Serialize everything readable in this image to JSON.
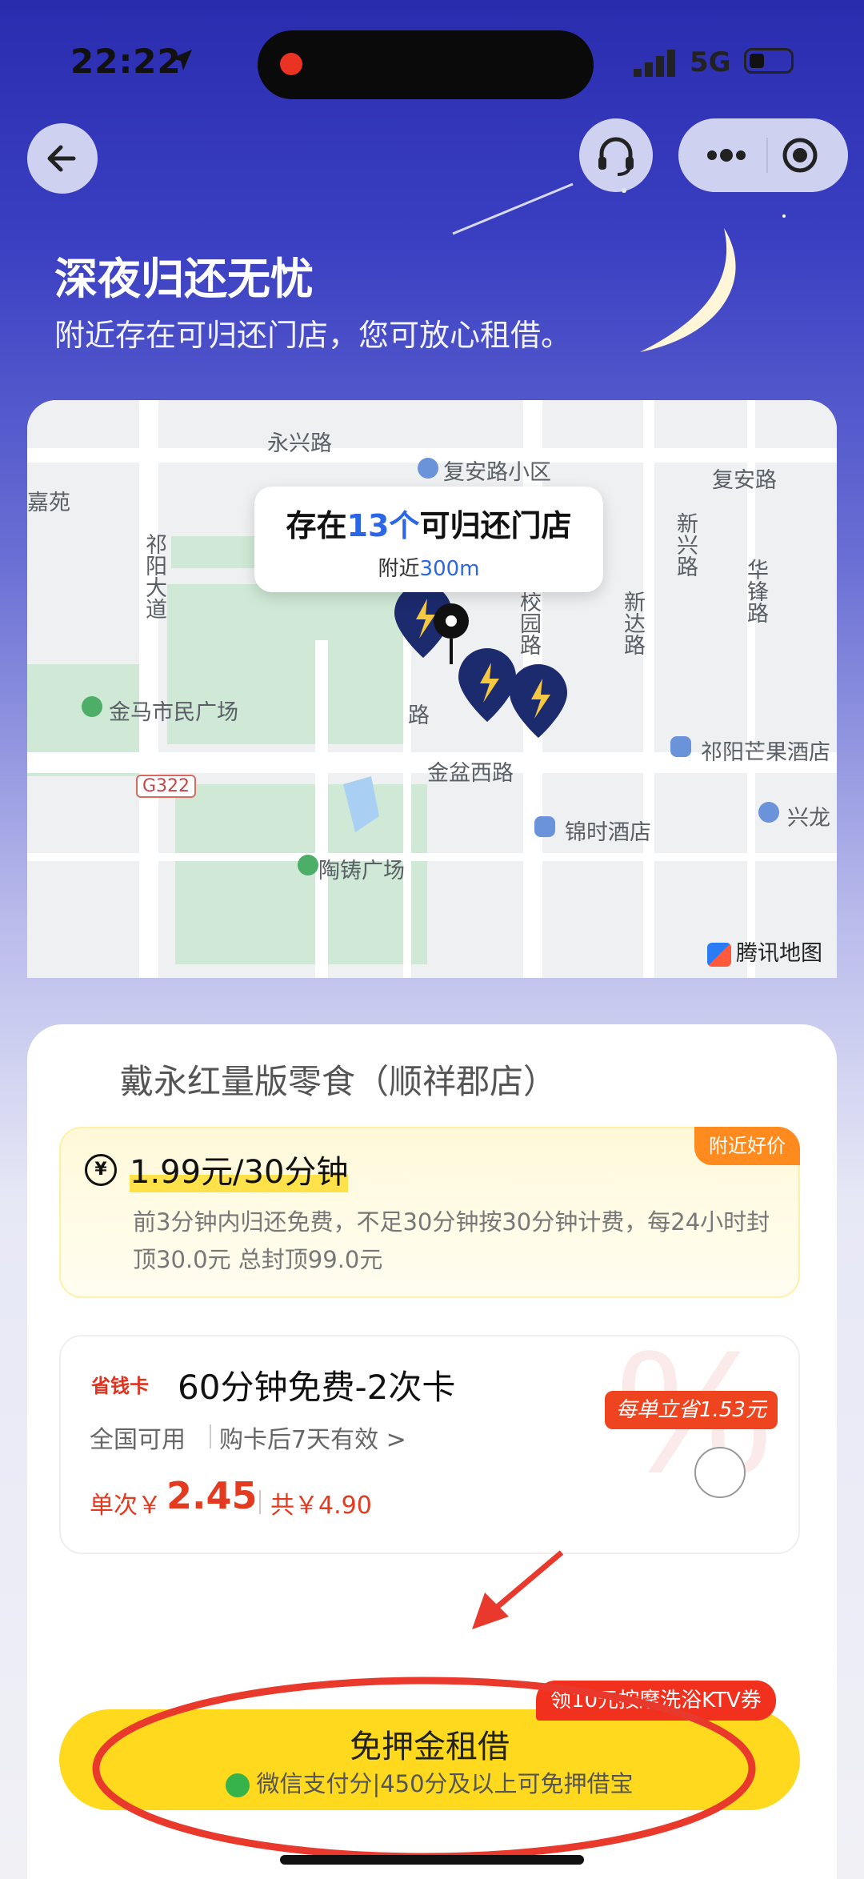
{
  "status_bar": {
    "time": "22:22",
    "network": "5G"
  },
  "banner": {
    "title": "深夜归还无忧",
    "subtitle": "附近存在可归还门店，您可放心租借。"
  },
  "map": {
    "bubble_prefix": "存在",
    "bubble_count": "13个",
    "bubble_suffix": "可归还门店",
    "bubble_near_prefix": "附近",
    "bubble_near_distance": "300m",
    "labels": {
      "yongxing": "永兴路",
      "fuan_xiaoqu": "复安路小区",
      "fuan": "复安路",
      "jiayuan": "嘉苑",
      "qiyang_dadao": "祁阳大道",
      "xiaoyuan": "校园路",
      "xinda": "新达路",
      "xinxing": "新兴路",
      "huafeng": "华锋路",
      "jinma": "金马市民广场",
      "lu": "路",
      "jinpen": "金盆西路",
      "mango_hotel": "祁阳芒果酒店",
      "g322": "G322",
      "jinshi_hotel": "锦时酒店",
      "xinglong": "兴龙",
      "taozhu": "陶铸广场"
    },
    "provider": "腾讯地图"
  },
  "store": {
    "name": "戴永红量版零食（顺祥郡店）"
  },
  "pricing": {
    "badge": "附近好价",
    "currency_icon": "¥",
    "price": "1.99元/30分钟",
    "description": "前3分钟内归还免费，不足30分钟按30分钟计费，每24小时封顶30.0元 总封顶99.0元"
  },
  "coupon": {
    "badge": "省钱卡",
    "title": "60分钟免费-2次卡",
    "validity_scope": "全国可用",
    "validity_period": "购卡后7天有效 >",
    "single_label": "单次￥",
    "single_price": "2.45",
    "total": "共￥4.90",
    "saving_badge": "每单立省1.53元"
  },
  "cta": {
    "promo": "领10元按摩洗浴KTV券",
    "label": "免押金租借",
    "sub": "微信支付分|450分及以上可免押借宝"
  },
  "colors": {
    "accent_yellow": "#ffd91d",
    "brand_blue": "#2a66e6",
    "price_red": "#e43a1f",
    "annotation_red": "#e8392c"
  },
  "icons": [
    "back-arrow-icon",
    "headset-icon",
    "more-dots-icon",
    "target-icon",
    "yuan-coin-icon",
    "lightning-pin-icon",
    "wechat-pay-icon",
    "location-arrow-icon"
  ]
}
